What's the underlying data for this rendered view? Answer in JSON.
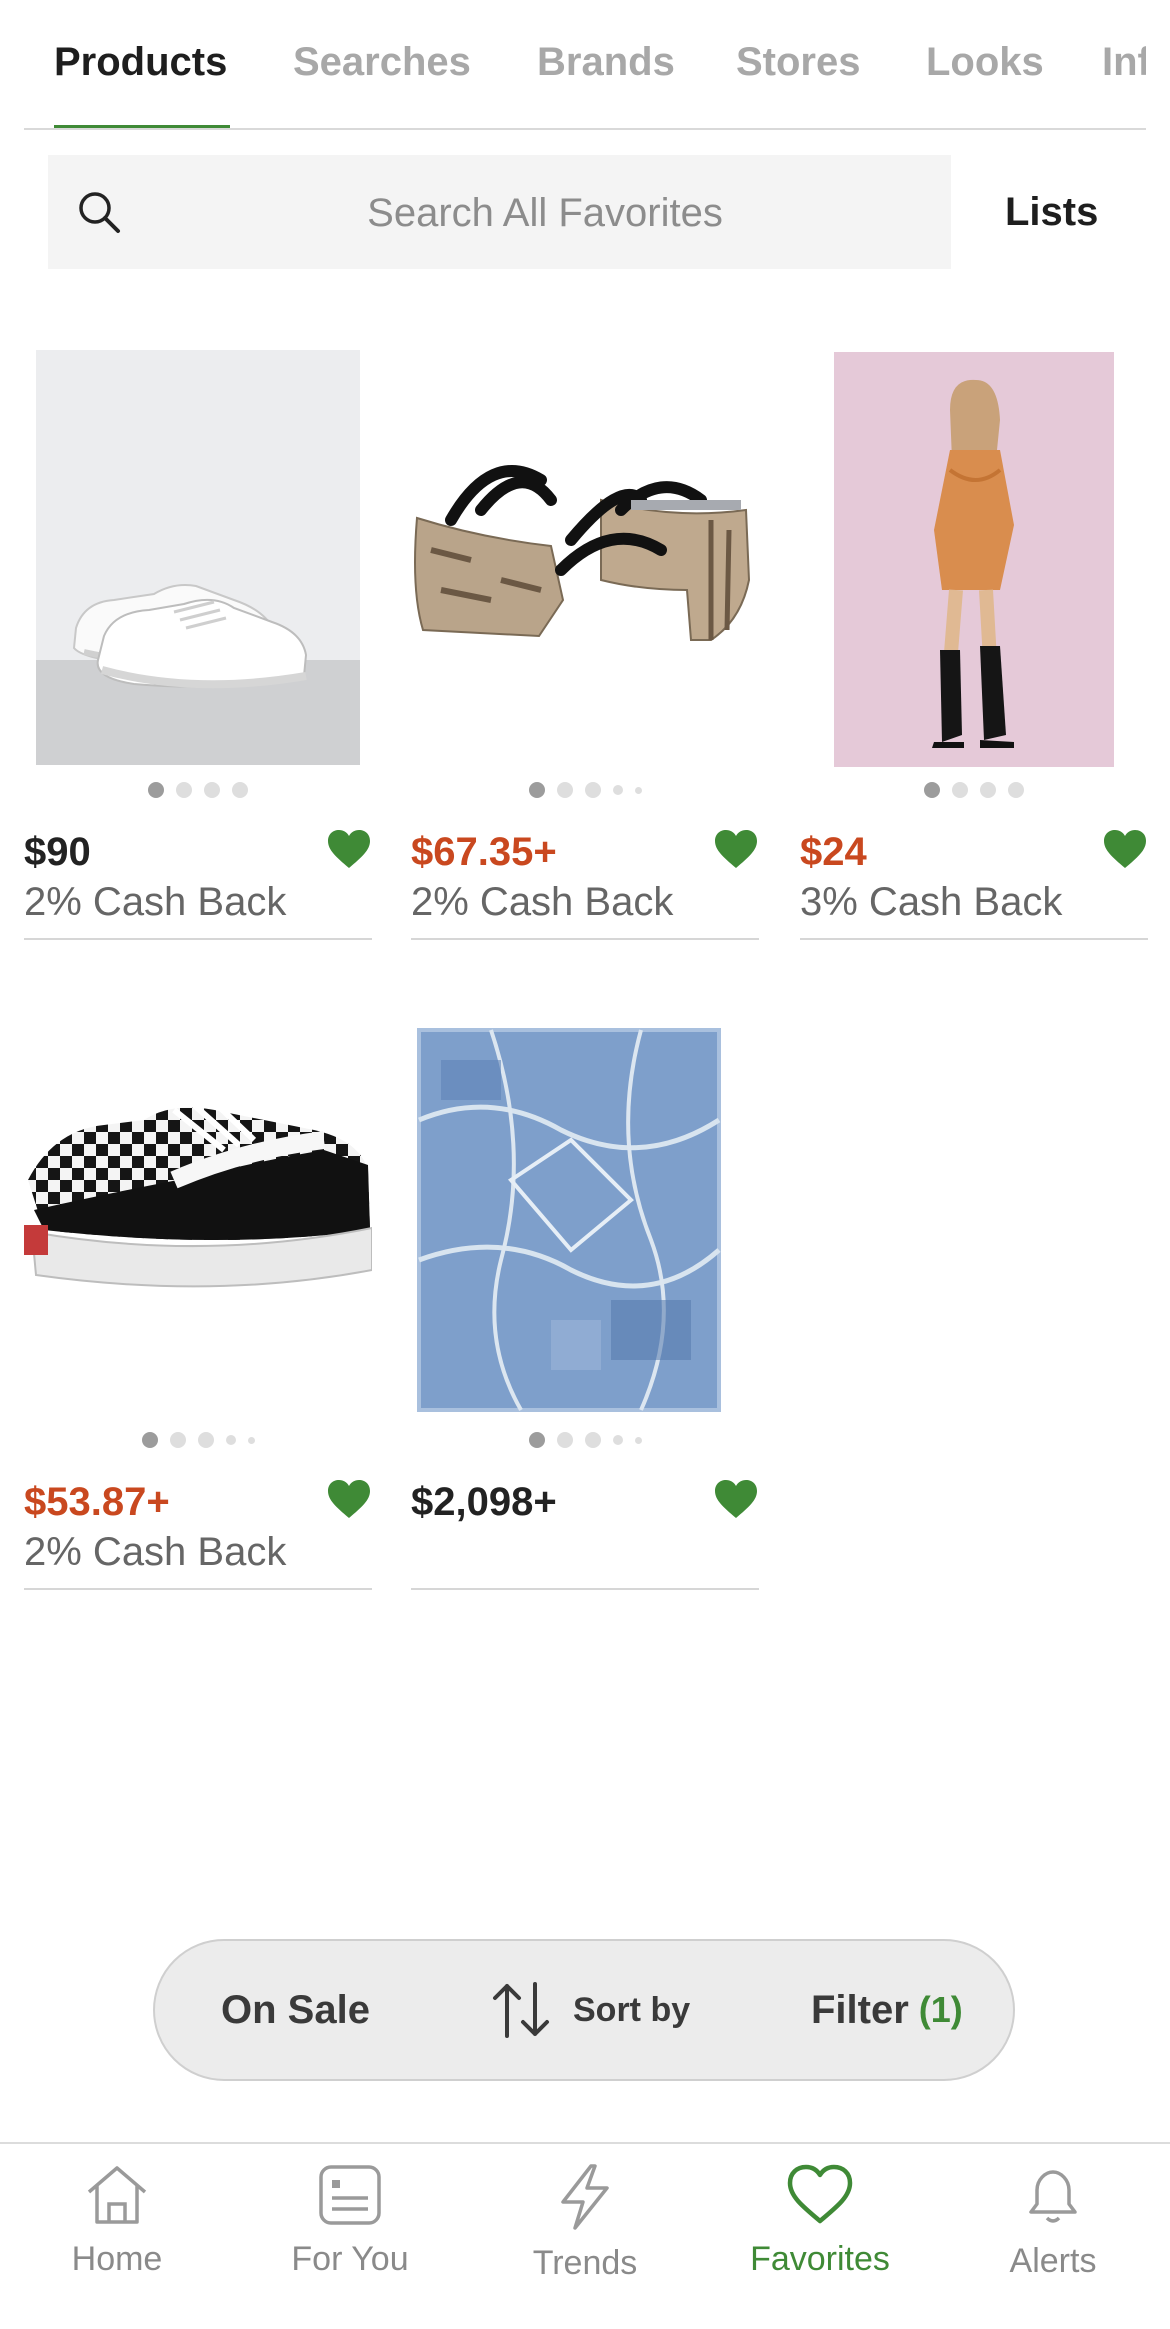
{
  "tabs": [
    {
      "label": "Products"
    },
    {
      "label": "Searches"
    },
    {
      "label": "Brands"
    },
    {
      "label": "Stores"
    },
    {
      "label": "Looks"
    },
    {
      "label": "Inf"
    }
  ],
  "active_tab": "Products",
  "search": {
    "placeholder": "Search All Favorites",
    "value": ""
  },
  "lists_label": "Lists",
  "products": [
    {
      "price": "$90",
      "cashback": "2% Cash Back",
      "on_sale": false,
      "favorited": true,
      "image": "white-sneakers",
      "image_count": 4,
      "image_index": 1
    },
    {
      "price": "$67.35+",
      "cashback": "2% Cash Back",
      "on_sale": true,
      "favorited": true,
      "image": "snakeskin-strappy-heels",
      "image_count": 5,
      "image_index": 1
    },
    {
      "price": "$24",
      "cashback": "3% Cash Back",
      "on_sale": true,
      "favorited": true,
      "image": "orange-slip-dress",
      "image_count": 4,
      "image_index": 1
    },
    {
      "price": "$53.87+",
      "cashback": "2% Cash Back",
      "on_sale": true,
      "favorited": true,
      "image": "checkered-platform-sneakers",
      "image_count": 5,
      "image_index": 1
    },
    {
      "price": "$2,098+",
      "cashback": "",
      "on_sale": false,
      "favorited": true,
      "image": "blue-area-rug",
      "image_count": 5,
      "image_index": 1
    }
  ],
  "action_bar": {
    "on_sale": "On Sale",
    "sort_by": "Sort by",
    "filter": "Filter",
    "filter_count": "(1)"
  },
  "bottom_nav": [
    {
      "label": "Home",
      "icon": "home-icon"
    },
    {
      "label": "For You",
      "icon": "for-you-icon"
    },
    {
      "label": "Trends",
      "icon": "lightning-icon"
    },
    {
      "label": "Favorites",
      "icon": "heart-icon"
    },
    {
      "label": "Alerts",
      "icon": "bell-icon"
    }
  ],
  "active_nav": "Favorites",
  "colors": {
    "accent": "#3f8a36",
    "sale": "#c9481f",
    "text": "#1e1e1e",
    "muted": "#a8a8a8"
  }
}
